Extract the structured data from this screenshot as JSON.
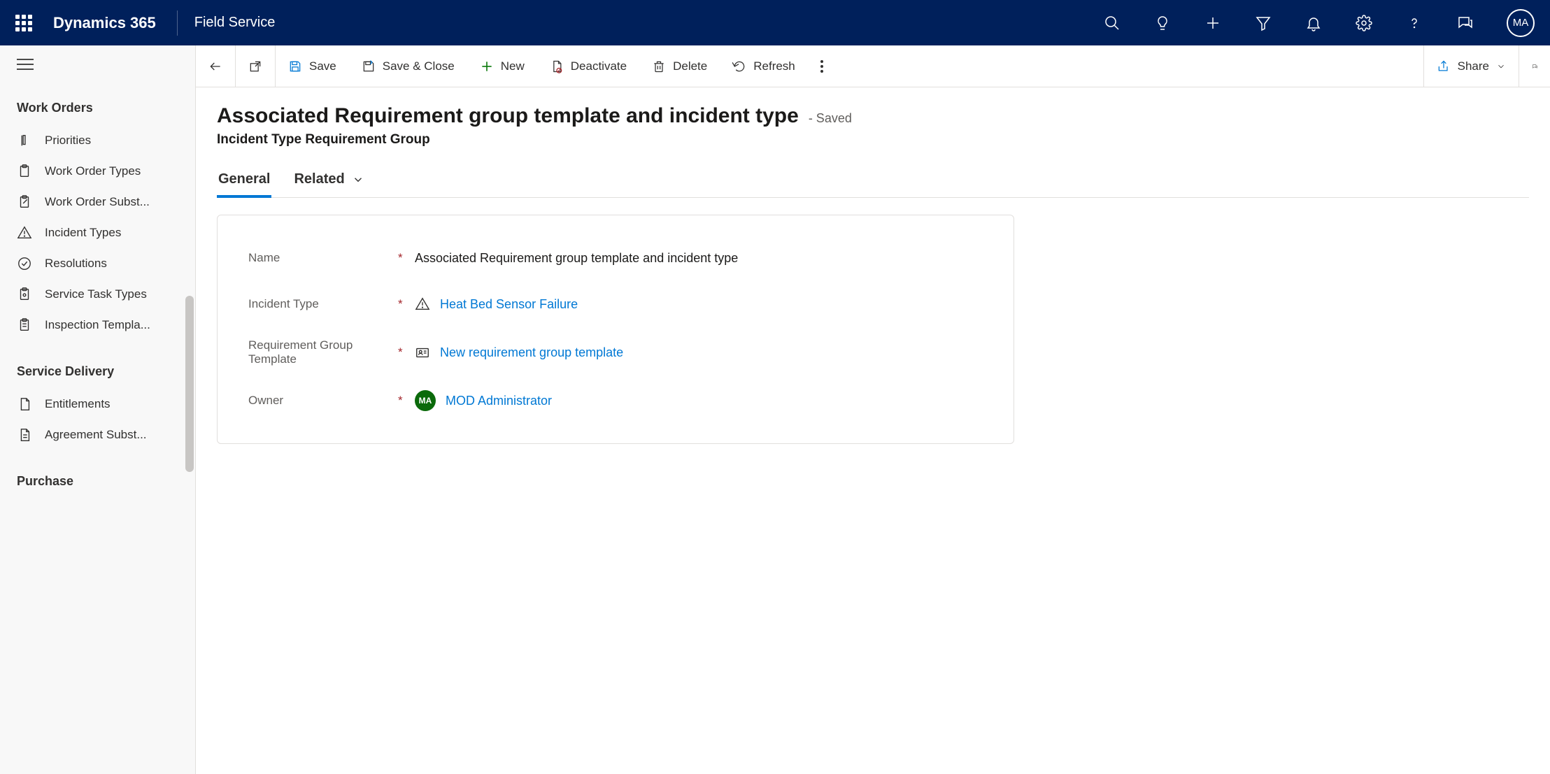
{
  "topbar": {
    "brand": "Dynamics 365",
    "context": "Field Service",
    "avatar_initials": "MA"
  },
  "sidebar": {
    "sections": [
      {
        "header": "Work Orders",
        "items": [
          {
            "label": "Priorities",
            "icon": "priority"
          },
          {
            "label": "Work Order Types",
            "icon": "clipboard"
          },
          {
            "label": "Work Order Subst...",
            "icon": "clipboard-edit"
          },
          {
            "label": "Incident Types",
            "icon": "warning"
          },
          {
            "label": "Resolutions",
            "icon": "check-circle"
          },
          {
            "label": "Service Task Types",
            "icon": "clipboard-gear"
          },
          {
            "label": "Inspection Templa...",
            "icon": "clipboard-list"
          }
        ]
      },
      {
        "header": "Service Delivery",
        "items": [
          {
            "label": "Entitlements",
            "icon": "document"
          },
          {
            "label": "Agreement Subst...",
            "icon": "document-lines"
          }
        ]
      },
      {
        "header": "Purchase",
        "items": []
      }
    ]
  },
  "commands": {
    "save": "Save",
    "save_close": "Save & Close",
    "new": "New",
    "deactivate": "Deactivate",
    "delete": "Delete",
    "refresh": "Refresh",
    "share": "Share"
  },
  "page": {
    "title": "Associated Requirement group template and incident type",
    "status": "- Saved",
    "subtitle": "Incident Type Requirement Group",
    "tabs": {
      "general": "General",
      "related": "Related"
    }
  },
  "form": {
    "name_label": "Name",
    "name_value": "Associated Requirement group template and incident type",
    "incident_type_label": "Incident Type",
    "incident_type_value": "Heat Bed Sensor Failure",
    "req_group_label": "Requirement Group Template",
    "req_group_value": "New requirement group template",
    "owner_label": "Owner",
    "owner_initials": "MA",
    "owner_value": "MOD Administrator"
  }
}
